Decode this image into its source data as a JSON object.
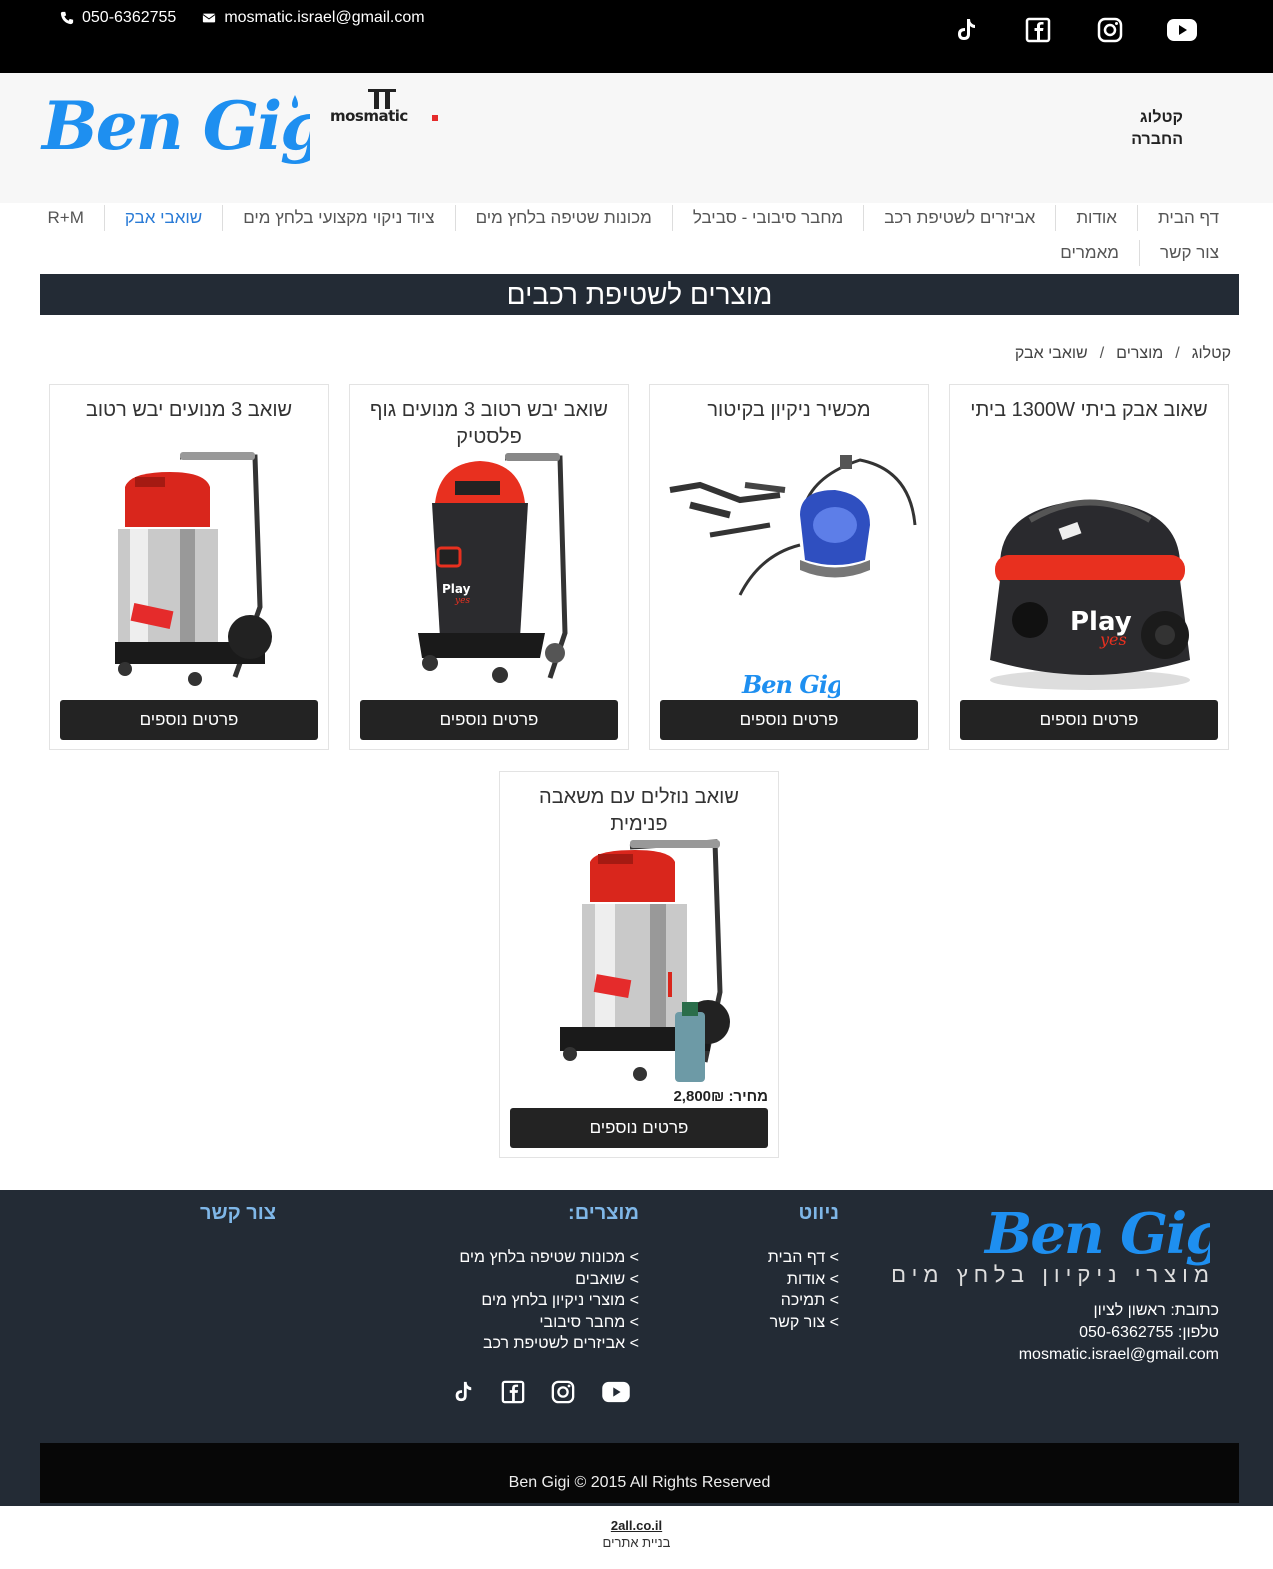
{
  "topbar": {
    "phone": "050-6362755",
    "email": "mosmatic.israel@gmail.com",
    "social": [
      "tiktok-icon",
      "facebook-icon",
      "instagram-icon",
      "youtube-icon"
    ]
  },
  "header": {
    "logo_text": "Ben Gigi",
    "brand2": "mosmatic",
    "catalog_line1": "קטלוג",
    "catalog_line2": "החברה"
  },
  "nav": {
    "row1": [
      "דף הבית",
      "אודות",
      "אביזרים לשטיפת רכב",
      "מחבר סיבובי - סביבל",
      "מכונות שטיפה בלחץ מים",
      "ציוד ניקוי מקצועי בלחץ מים",
      "שואבי אבק",
      "R+M"
    ],
    "row2": [
      "צור קשר",
      "מאמרים"
    ],
    "active": "שואבי אבק"
  },
  "page_title": "מוצרים לשטיפת רכבים",
  "breadcrumb": [
    "קטלוג",
    "מוצרים",
    "שואבי אבק"
  ],
  "products": [
    {
      "title": "שאוב אבק ביתי 1300W ביתי",
      "button": "פרטים נוספים",
      "image": "red-black-vacuum"
    },
    {
      "title": "מכשיר ניקיון בקיטור",
      "button": "פרטים נוספים",
      "image": "blue-steam-cleaner"
    },
    {
      "title": "שואב יבש רטוב 3 מנועים גוף פלסטיק",
      "button": "פרטים נוספים",
      "image": "black-wet-dry-vacuum"
    },
    {
      "title": "שואב 3 מנועים יבש רטוב",
      "button": "פרטים נוספים",
      "image": "steel-wet-dry-vacuum"
    },
    {
      "title": "שואב נוזלים עם משאבה פנימית",
      "button": "פרטים נוספים",
      "price_label": "מחיר:",
      "price": "2,800₪",
      "image": "steel-vacuum-with-pump"
    }
  ],
  "watermark": "Ben Gigi",
  "footer": {
    "logo_text": "Ben Gigi",
    "tagline": "מוצרי ניקיון בלחץ מים",
    "address": "כתובת: ראשון לציון",
    "phone": "טלפון: 050-6362755",
    "email": "mosmatic.israel@gmail.com",
    "nav_heading": "ניווט",
    "nav_items": [
      "> דף הבית",
      "> אודות",
      "> תמיכה",
      "> צור קשר"
    ],
    "products_heading": "מוצרים:",
    "product_items": [
      ">  מכונות שטיפה בלחץ מים",
      "> שואבים",
      "> מוצרי ניקיון בלחץ מים",
      "> מחבר סיבובי",
      "> אביזרים לשטיפת רכב"
    ],
    "contact_heading": "צור קשר",
    "copyright": "Ben Gigi © 2015 All Rights Reserved"
  },
  "credit": {
    "logo": "2all.co.il",
    "text": "בניית אתרים"
  },
  "colors": {
    "topbar": "#000000",
    "title_band": "#232b35",
    "accent_blue": "#2a7bd6",
    "footer_heading": "#7fb7e8",
    "button": "#232323"
  }
}
